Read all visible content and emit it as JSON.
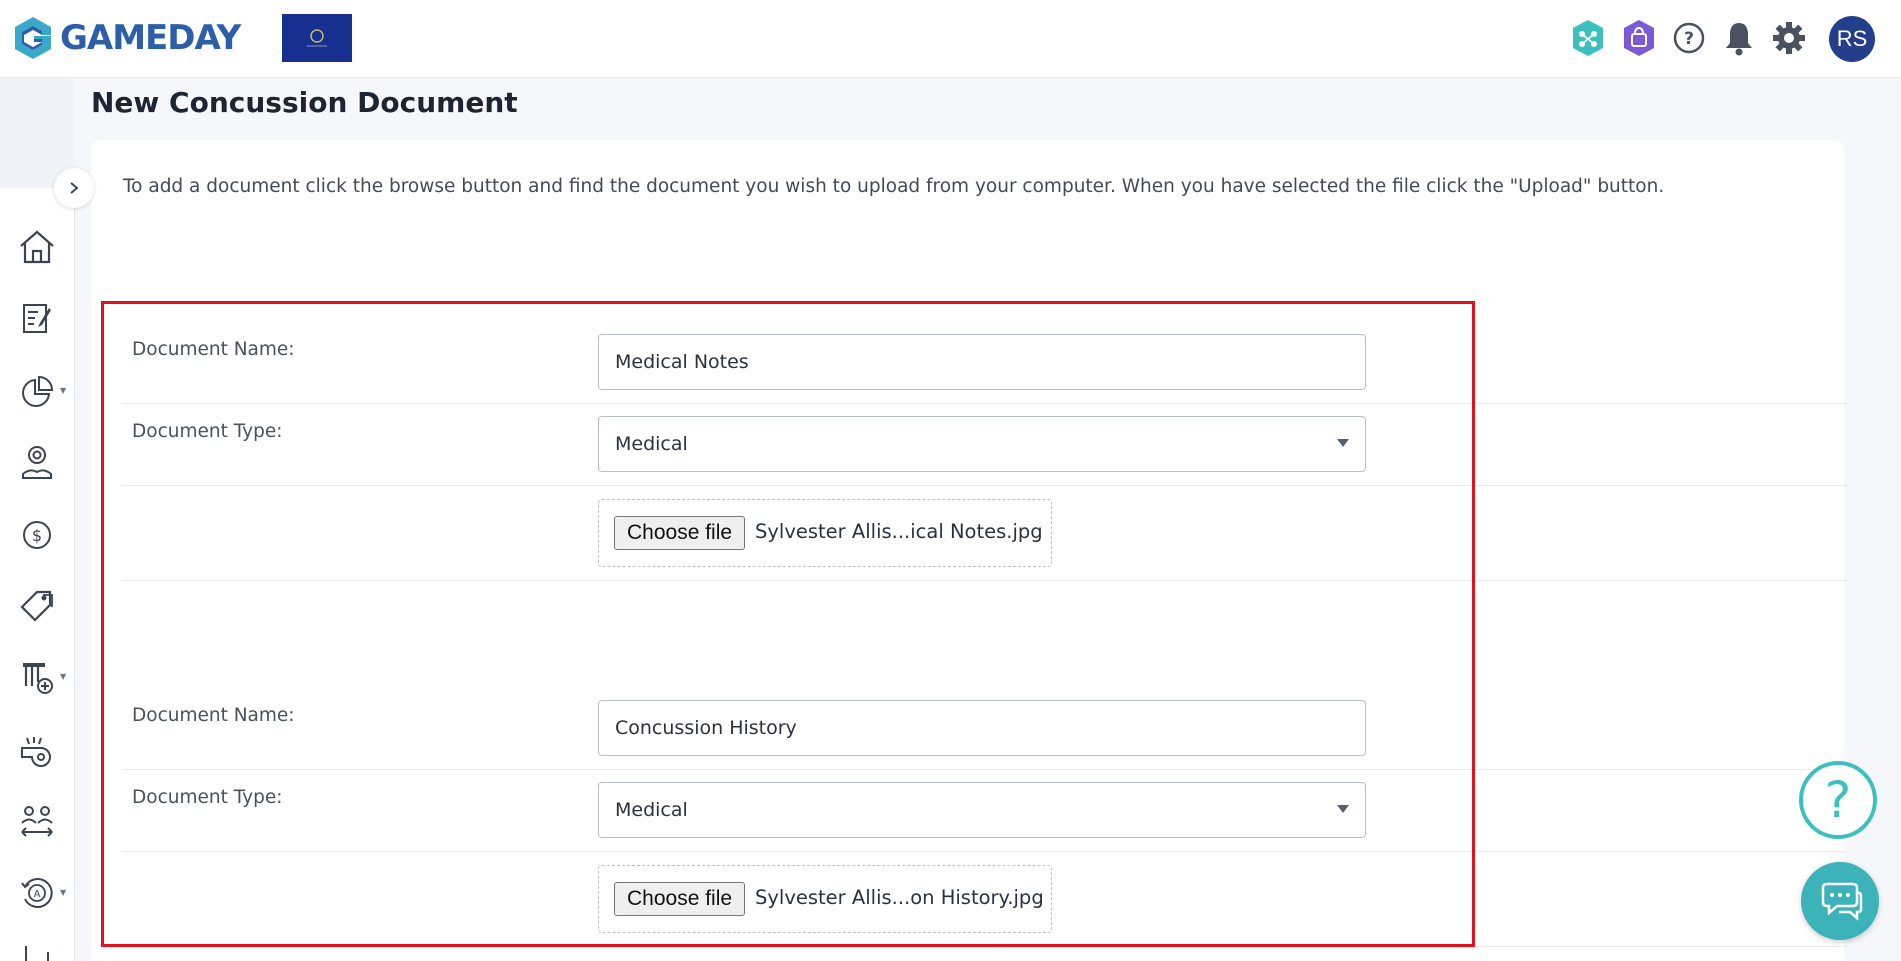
{
  "header": {
    "brand": "GAMEDAY",
    "avatar_initials": "RS",
    "icons": [
      "passport-icon",
      "shop-icon",
      "help-icon",
      "bell-icon",
      "gear-icon"
    ]
  },
  "sidebar": {
    "items": [
      {
        "icon": "home-icon"
      },
      {
        "icon": "registration-form-icon"
      },
      {
        "icon": "reports-pie-icon",
        "has_caret": true
      },
      {
        "icon": "members-icon"
      },
      {
        "icon": "finance-dollar-icon"
      },
      {
        "icon": "products-tag-icon"
      },
      {
        "icon": "competitions-icon",
        "has_caret": true
      },
      {
        "icon": "whistle-icon"
      },
      {
        "icon": "transfers-icon"
      },
      {
        "icon": "accreditation-icon",
        "has_caret": true
      }
    ]
  },
  "page": {
    "title": "New Concussion Document",
    "instructions": "To add a document click the browse button and find the document you wish to upload from your computer. When you have selected the file click the \"Upload\" button."
  },
  "documents": [
    {
      "name_label": "Document Name:",
      "name_value": "Medical Notes",
      "type_label": "Document Type:",
      "type_value": "Medical",
      "file_button": "Choose file",
      "file_name": "Sylvester Allis...ical Notes.jpg"
    },
    {
      "name_label": "Document Name:",
      "name_value": "Concussion History",
      "type_label": "Document Type:",
      "type_value": "Medical",
      "file_button": "Choose file",
      "file_name": "Sylvester Allis...on History.jpg"
    }
  ],
  "floating": {
    "help_glyph": "?"
  },
  "colors": {
    "brand_blue": "#2c5fa8",
    "avatar_bg": "#233e8b",
    "highlight": "#e0121b",
    "teal": "#3cbfbf"
  }
}
